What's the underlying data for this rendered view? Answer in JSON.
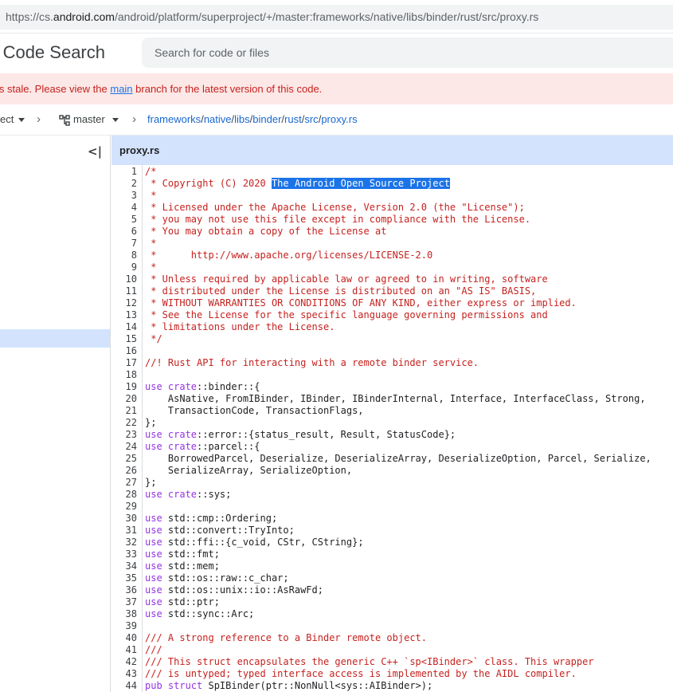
{
  "browser": {
    "url_scheme": "https://cs.",
    "url_host": "android.com",
    "url_path": "/android/platform/superproject/+/master:frameworks/native/libs/binder/rust/src/proxy.rs"
  },
  "header": {
    "brand": "l Code Search",
    "search_placeholder": "Search for code or files"
  },
  "banner": {
    "text_before": "is stale. Please view the ",
    "link": "main",
    "text_after": " branch for the latest version of this code."
  },
  "breadcrumb": {
    "project": "ect",
    "branch": "master",
    "path_parts": [
      "frameworks",
      "native",
      "libs",
      "binder",
      "rust",
      "src",
      "proxy.rs"
    ]
  },
  "file": {
    "name": "proxy.rs"
  },
  "colors": {
    "accent": "#1a73e8",
    "banner_bg": "#fce8e6",
    "tab_bg": "#d3e3fd",
    "comment": "#c5221f",
    "keyword": "#9334e6"
  },
  "icons": {
    "collapse": "collapse-panel-icon",
    "branch": "branch-icon"
  },
  "code_lines": [
    {
      "n": "1",
      "t": "/*",
      "c": true
    },
    {
      "n": "2",
      "t": " * Copyright (C) 2020 ",
      "c": true,
      "hl": "The Android Open Source Project"
    },
    {
      "n": "3",
      "t": " *",
      "c": true
    },
    {
      "n": "4",
      "t": " * Licensed under the Apache License, Version 2.0 (the \"License\");",
      "c": true
    },
    {
      "n": "5",
      "t": " * you may not use this file except in compliance with the License.",
      "c": true
    },
    {
      "n": "6",
      "t": " * You may obtain a copy of the License at",
      "c": true
    },
    {
      "n": "7",
      "t": " *",
      "c": true
    },
    {
      "n": "8",
      "t": " *      http://www.apache.org/licenses/LICENSE-2.0",
      "c": true
    },
    {
      "n": "9",
      "t": " *",
      "c": true
    },
    {
      "n": "10",
      "t": " * Unless required by applicable law or agreed to in writing, software",
      "c": true
    },
    {
      "n": "11",
      "t": " * distributed under the License is distributed on an \"AS IS\" BASIS,",
      "c": true
    },
    {
      "n": "12",
      "t": " * WITHOUT WARRANTIES OR CONDITIONS OF ANY KIND, either express or implied.",
      "c": true
    },
    {
      "n": "13",
      "t": " * See the License for the specific language governing permissions and",
      "c": true
    },
    {
      "n": "14",
      "t": " * limitations under the License.",
      "c": true
    },
    {
      "n": "15",
      "t": " */",
      "c": true
    },
    {
      "n": "16",
      "t": ""
    },
    {
      "n": "17",
      "t": "//! Rust API for interacting with a remote binder service.",
      "c": true
    },
    {
      "n": "18",
      "t": ""
    },
    {
      "n": "19",
      "k": "use ",
      "k2": "crate",
      "t": "::binder::{"
    },
    {
      "n": "20",
      "t": "    AsNative, FromIBinder, IBinder, IBinderInternal, Interface, InterfaceClass, Strong,"
    },
    {
      "n": "21",
      "t": "    TransactionCode, TransactionFlags,"
    },
    {
      "n": "22",
      "t": "};"
    },
    {
      "n": "23",
      "k": "use ",
      "k2": "crate",
      "t": "::error::{status_result, Result, StatusCode};"
    },
    {
      "n": "24",
      "k": "use ",
      "k2": "crate",
      "t": "::parcel::{"
    },
    {
      "n": "25",
      "t": "    BorrowedParcel, Deserialize, DeserializeArray, DeserializeOption, Parcel, Serialize,"
    },
    {
      "n": "26",
      "t": "    SerializeArray, SerializeOption,"
    },
    {
      "n": "27",
      "t": "};"
    },
    {
      "n": "28",
      "k": "use ",
      "k2": "crate",
      "t": "::sys;"
    },
    {
      "n": "29",
      "t": ""
    },
    {
      "n": "30",
      "k": "use ",
      "t": "std::cmp::Ordering;"
    },
    {
      "n": "31",
      "k": "use ",
      "t": "std::convert::TryInto;"
    },
    {
      "n": "32",
      "k": "use ",
      "t": "std::ffi::{c_void, CStr, CString};"
    },
    {
      "n": "33",
      "k": "use ",
      "t": "std::fmt;"
    },
    {
      "n": "34",
      "k": "use ",
      "t": "std::mem;"
    },
    {
      "n": "35",
      "k": "use ",
      "t": "std::os::raw::c_char;"
    },
    {
      "n": "36",
      "k": "use ",
      "t": "std::os::unix::io::AsRawFd;"
    },
    {
      "n": "37",
      "k": "use ",
      "t": "std::ptr;"
    },
    {
      "n": "38",
      "k": "use ",
      "t": "std::sync::Arc;"
    },
    {
      "n": "39",
      "t": ""
    },
    {
      "n": "40",
      "t": "/// A strong reference to a Binder remote object.",
      "c": true
    },
    {
      "n": "41",
      "t": "///",
      "c": true
    },
    {
      "n": "42",
      "t": "/// This struct encapsulates the generic C++ `sp<IBinder>` class. This wrapper",
      "c": true
    },
    {
      "n": "43",
      "t": "/// is untyped; typed interface access is implemented by the AIDL compiler.",
      "c": true
    },
    {
      "n": "44",
      "k": "pub struct ",
      "t": "SpIBinder(ptr::NonNull<sys::AIBinder>);"
    }
  ]
}
